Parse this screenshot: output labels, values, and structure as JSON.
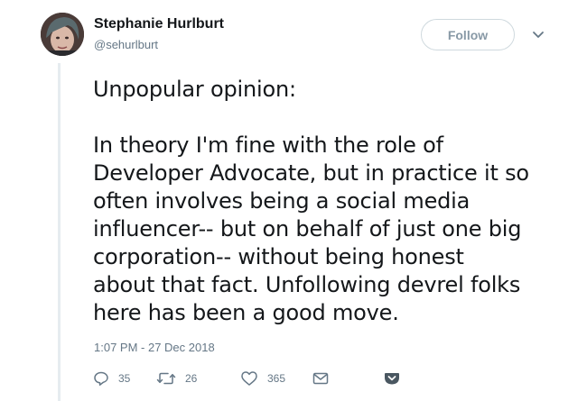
{
  "author": {
    "name": "Stephanie Hurlburt",
    "handle": "@sehurlburt"
  },
  "follow_label": "Follow",
  "tweet": {
    "text": "Unpopular opinion:\n\nIn theory I'm fine with the role of\nDeveloper Advocate, but in practice it so\noften involves being a social media\ninfluencer-- but on behalf of just one big\ncorporation-- without being honest\nabout that fact. Unfollowing devrel folks\nhere has been a good move.",
    "timestamp": "1:07 PM - 27 Dec 2018"
  },
  "actions": {
    "replies": "35",
    "retweets": "26",
    "likes": "365"
  },
  "icons": {
    "reply": "reply-icon",
    "retweet": "retweet-icon",
    "like": "heart-icon",
    "message": "envelope-icon",
    "pocket": "pocket-icon",
    "caret": "chevron-down-icon"
  },
  "colors": {
    "text": "#14171a",
    "secondary": "#657786",
    "border": "#e6ecf0",
    "pocket": "#4a5761"
  }
}
